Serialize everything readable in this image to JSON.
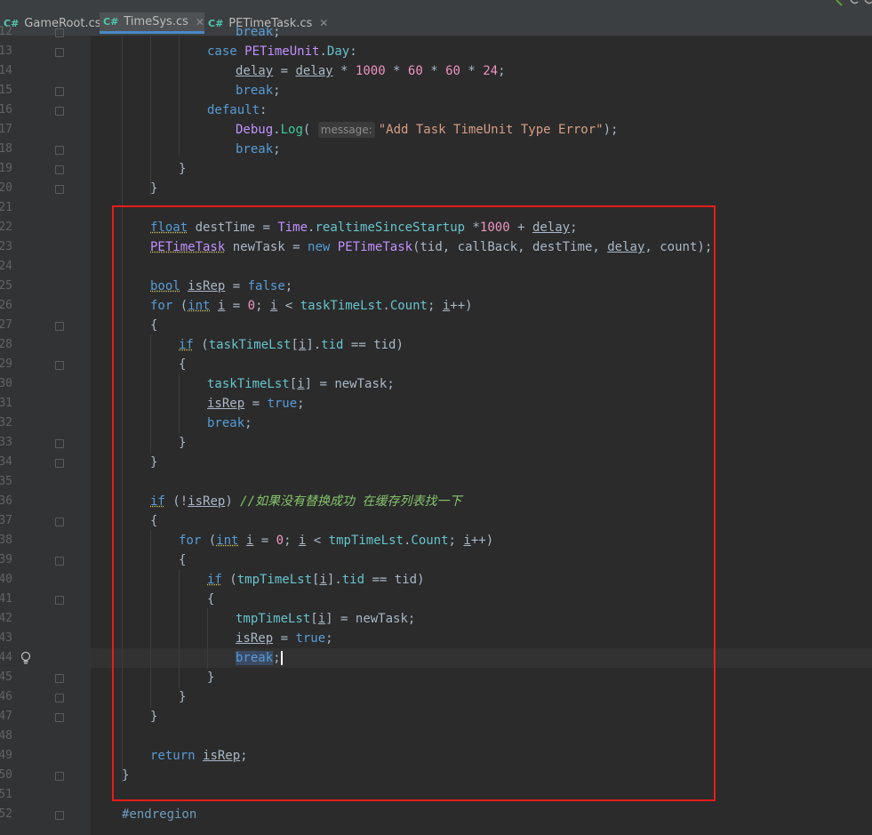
{
  "tabs": [
    {
      "lang": "C#",
      "label": "GameRoot.cs",
      "active": false
    },
    {
      "lang": "C#",
      "label": "TimeSys.cs",
      "active": true
    },
    {
      "lang": "C#",
      "label": "PETimeTask.cs",
      "active": false
    }
  ],
  "line_numbers": [
    "12",
    "13",
    "14",
    "15",
    "16",
    "17",
    "18",
    "19",
    "20",
    "21",
    "22",
    "23",
    "24",
    "25",
    "26",
    "27",
    "28",
    "29",
    "30",
    "31",
    "32",
    "33",
    "34",
    "35",
    "36",
    "37",
    "38",
    "39",
    "40",
    "41",
    "42",
    "43",
    "44",
    "45",
    "46",
    "47",
    "48",
    "49",
    "50",
    "51",
    "52"
  ],
  "code": {
    "l13_case": "case",
    "l13_unit": "PETimeUnit",
    "l13_day": "Day",
    "l14_delay": "delay",
    "l14_ops": " * 1000 * 60 * 60 * 24;",
    "l14_n1": "1000",
    "l14_n2": "60",
    "l14_n3": "60",
    "l14_n4": "24",
    "break": "break",
    "default": "default",
    "l17_debug": "Debug",
    "l17_log": "Log",
    "l17_hint": "message:",
    "l17_str": "\"Add Task TimeUnit Type Error\"",
    "l22_float": "float",
    "l22_destTime": "destTime",
    "l22_time": "Time",
    "l22_rt": "realtimeSinceStartup",
    "l22_num": "1000",
    "l23_type": "PETimeTask",
    "l23_newTask": "newTask",
    "l23_new": "new",
    "l23_args": "(tid, callBack, destTime, ",
    "l23_count": ", count);",
    "l25_bool": "bool",
    "l25_isRep": "isRep",
    "l25_false": "false",
    "for": "for",
    "int": "int",
    "i": "i",
    "zero": "0",
    "taskTimeLst": "taskTimeLst",
    "tmpTimeLst": "tmpTimeLst",
    "Count": "Count",
    "if": "if",
    "tid": "tid",
    "true": "true",
    "l36_comment": "//如果没有替换成功 在缓存列表找一下",
    "return": "return",
    "endregion": "#endregion"
  },
  "colors": {
    "accent_box": "#e81b1b",
    "tab_active_underline": "#4a88c7"
  },
  "icons": [
    "csharp-file-icon",
    "close-icon",
    "lightbulb-icon",
    "fold-marker-icon"
  ]
}
